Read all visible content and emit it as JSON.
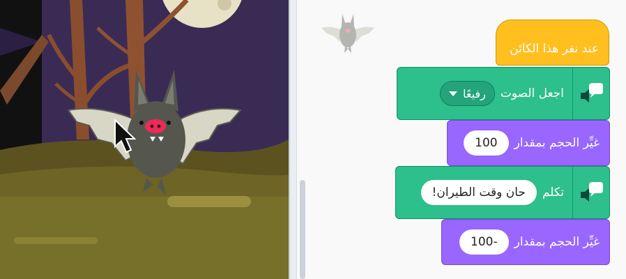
{
  "stage": {
    "sprite_name": "bat-sprite"
  },
  "workspace": {
    "blocks": [
      {
        "id": "when-clicked",
        "text": "عند نقر هذا الكائن",
        "category": "events",
        "color": "#ffbf1f"
      },
      {
        "id": "set-voice",
        "text": "اجعل الصوت",
        "dropdown": "رفيعًا",
        "category": "text-to-speech",
        "color": "#2dbf8c"
      },
      {
        "id": "change-size-1",
        "text": "غيِّر الحجم بمقدار",
        "value": "100",
        "category": "looks",
        "color": "#9966ff"
      },
      {
        "id": "speak",
        "text": "تكلم",
        "value": "حان وقت الطيران!",
        "category": "text-to-speech",
        "color": "#2dbf8c"
      },
      {
        "id": "change-size-2",
        "text": "غيِّر الحجم بمقدار",
        "value": "-100",
        "category": "looks",
        "color": "#9966ff"
      }
    ]
  },
  "icons": {
    "speech": "speech-bubble-speaker-icon",
    "cursor": "mouse-pointer-icon"
  }
}
